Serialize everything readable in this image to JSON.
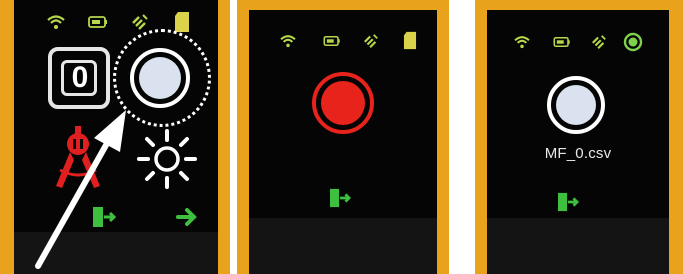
{
  "screens": [
    {
      "status_icons": [
        "wifi-icon",
        "battery-icon",
        "satellite-icon",
        "sd-card-icon"
      ],
      "counter": {
        "value": "0"
      },
      "record_button": {
        "state": "idle",
        "highlight": "dotted-circle"
      },
      "tools": [
        "compass-icon",
        "brightness-icon"
      ],
      "footer_icons": [
        "exit-icon",
        "next-arrow-icon"
      ],
      "pointer": "white-arrow"
    },
    {
      "status_icons": [
        "wifi-icon",
        "battery-icon",
        "satellite-icon",
        "sd-card-icon"
      ],
      "record_button": {
        "state": "recording"
      },
      "footer_icons": [
        "exit-icon"
      ]
    },
    {
      "status_icons": [
        "wifi-icon",
        "battery-icon",
        "satellite-icon",
        "recording-indicator-icon"
      ],
      "record_button": {
        "state": "idle"
      },
      "file_label": "MF_0.csv",
      "footer_icons": [
        "exit-icon"
      ]
    }
  ],
  "colors": {
    "case": "#e8a21c",
    "screen": "#050505",
    "status_green": "#7fd04a",
    "status_yellow": "#d9d24a",
    "record_red": "#e8231c",
    "compass_red": "#e02020",
    "button_white": "#d9e2ee",
    "exit_green": "#3fbf3f"
  }
}
